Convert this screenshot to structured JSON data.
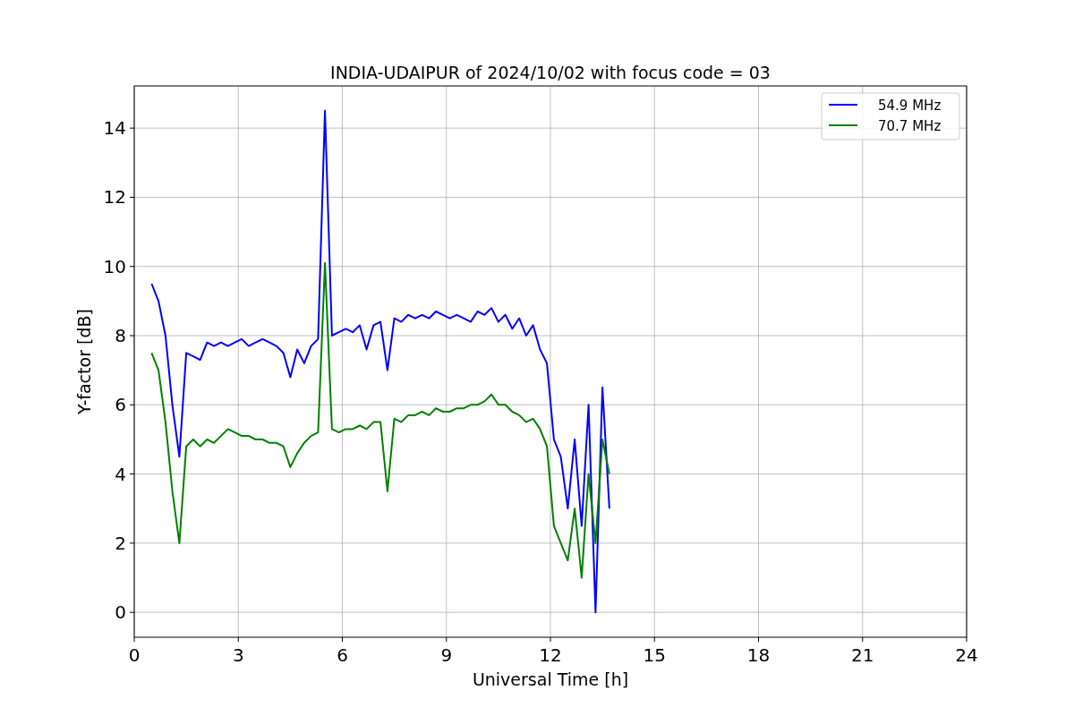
{
  "figure": {
    "chart_data": {
      "type": "line",
      "title": "INDIA-UDAIPUR of 2024/10/02 with focus code = 03",
      "xlabel": "Universal Time [h]",
      "ylabel": "Y-factor [dB]",
      "xlim": [
        0,
        24
      ],
      "ylim": [
        -0.72,
        15.22
      ],
      "xticks": [
        0,
        3,
        6,
        9,
        12,
        15,
        18,
        21,
        24
      ],
      "yticks": [
        0,
        2,
        4,
        6,
        8,
        10,
        12,
        14
      ],
      "grid": true,
      "legend": true,
      "x": [
        0.5,
        0.7,
        0.9,
        1.1,
        1.3,
        1.5,
        1.7,
        1.9,
        2.1,
        2.3,
        2.5,
        2.7,
        2.9,
        3.1,
        3.3,
        3.5,
        3.7,
        3.9,
        4.1,
        4.3,
        4.5,
        4.7,
        4.9,
        5.1,
        5.3,
        5.5,
        5.7,
        5.9,
        6.1,
        6.3,
        6.5,
        6.7,
        6.9,
        7.1,
        7.3,
        7.5,
        7.7,
        7.9,
        8.1,
        8.3,
        8.5,
        8.7,
        8.9,
        9.1,
        9.3,
        9.5,
        9.7,
        9.9,
        10.1,
        10.3,
        10.5,
        10.7,
        10.9,
        11.1,
        11.3,
        11.5,
        11.7,
        11.9,
        12.1,
        12.3,
        12.5,
        12.7,
        12.9,
        13.1,
        13.3,
        13.5,
        13.7
      ],
      "series": [
        {
          "name": "54.9 MHz",
          "color": "#0000ff",
          "values": [
            9.5,
            9.0,
            8.0,
            6.0,
            4.5,
            7.5,
            7.4,
            7.3,
            7.8,
            7.7,
            7.8,
            7.7,
            7.8,
            7.9,
            7.7,
            7.8,
            7.9,
            7.8,
            7.7,
            7.5,
            6.8,
            7.6,
            7.2,
            7.7,
            7.9,
            14.5,
            8.0,
            8.1,
            8.2,
            8.1,
            8.3,
            7.6,
            8.3,
            8.4,
            7.0,
            8.5,
            8.4,
            8.6,
            8.5,
            8.6,
            8.5,
            8.7,
            8.6,
            8.5,
            8.6,
            8.5,
            8.4,
            8.7,
            8.6,
            8.8,
            8.4,
            8.6,
            8.2,
            8.5,
            8.0,
            8.3,
            7.6,
            7.2,
            5.0,
            4.5,
            3.0,
            5.0,
            2.5,
            6.0,
            0.0,
            6.5,
            3.0
          ]
        },
        {
          "name": "70.7 MHz",
          "color": "#008000",
          "values": [
            7.5,
            7.0,
            5.5,
            3.5,
            2.0,
            4.8,
            5.0,
            4.8,
            5.0,
            4.9,
            5.1,
            5.3,
            5.2,
            5.1,
            5.1,
            5.0,
            5.0,
            4.9,
            4.9,
            4.8,
            4.2,
            4.6,
            4.9,
            5.1,
            5.2,
            10.1,
            5.3,
            5.2,
            5.3,
            5.3,
            5.4,
            5.3,
            5.5,
            5.5,
            3.5,
            5.6,
            5.5,
            5.7,
            5.7,
            5.8,
            5.7,
            5.9,
            5.8,
            5.8,
            5.9,
            5.9,
            6.0,
            6.0,
            6.1,
            6.3,
            6.0,
            6.0,
            5.8,
            5.7,
            5.5,
            5.6,
            5.3,
            4.8,
            2.5,
            2.0,
            1.5,
            3.0,
            1.0,
            4.0,
            2.0,
            5.0,
            4.0
          ]
        }
      ]
    }
  }
}
